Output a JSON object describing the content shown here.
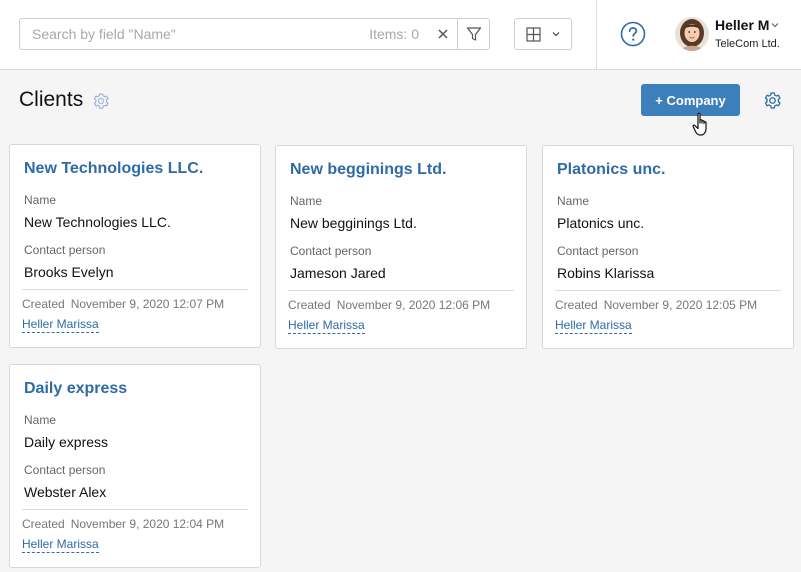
{
  "search": {
    "placeholder": "Search by field \"Name\"",
    "value": "",
    "items_label": "Items: 0"
  },
  "user": {
    "name": "Heller M",
    "company": "TeleCom Ltd."
  },
  "page": {
    "title": "Clients",
    "add_button_label": "+ Company"
  },
  "colors": {
    "accent": "#3d7fba",
    "link": "#2e6ba7"
  },
  "field_labels": {
    "name": "Name",
    "contact": "Contact person",
    "created": "Created"
  },
  "cards": [
    {
      "title": "New Technologies LLC.",
      "name": "New Technologies LLC.",
      "contact": "Brooks Evelyn",
      "created": "November 9, 2020 12:07 PM",
      "author": "Heller Marissa"
    },
    {
      "title": "New begginings Ltd.",
      "name": "New begginings Ltd.",
      "contact": "Jameson Jared",
      "created": "November 9, 2020 12:06 PM",
      "author": "Heller Marissa"
    },
    {
      "title": "Platonics unc.",
      "name": "Platonics unc.",
      "contact": "Robins Klarissa",
      "created": "November 9, 2020 12:05 PM",
      "author": "Heller Marissa"
    },
    {
      "title": "Daily express",
      "name": "Daily express",
      "contact": "Webster Alex",
      "created": "November 9, 2020 12:04 PM",
      "author": "Heller Marissa"
    }
  ]
}
